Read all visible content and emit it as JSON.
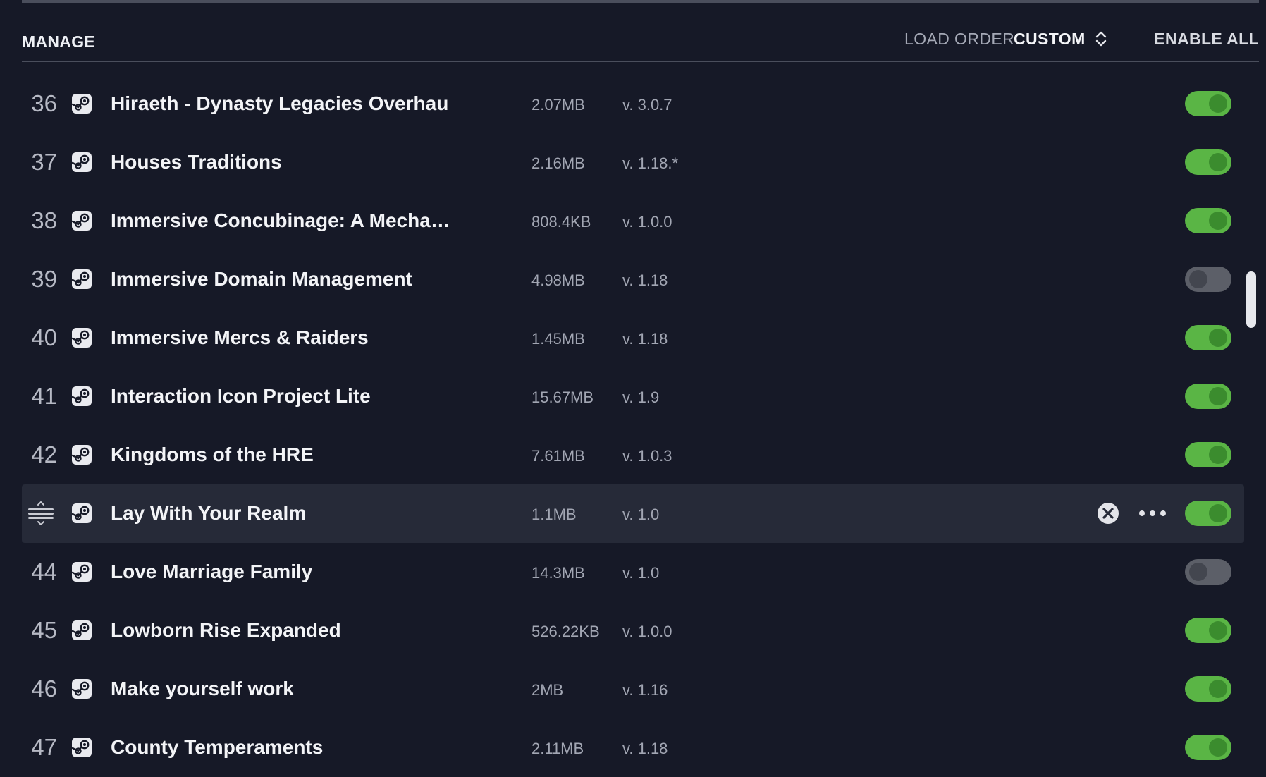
{
  "header": {
    "manage_label": "MANAGE",
    "load_order_label": "LOAD ORDER",
    "load_order_value": "CUSTOM",
    "enable_all_label": "ENABLE ALL"
  },
  "mods": [
    {
      "num": "36",
      "name": "Hiraeth - Dynasty Legacies Overhaul",
      "size": "2.07MB",
      "version": "v. 3.0.7",
      "enabled": true,
      "highlighted": false
    },
    {
      "num": "37",
      "name": "Houses Traditions",
      "size": "2.16MB",
      "version": "v. 1.18.*",
      "enabled": true,
      "highlighted": false
    },
    {
      "num": "38",
      "name": "Immersive Concubinage: A Mecha…",
      "size": "808.4KB",
      "version": "v. 1.0.0",
      "enabled": true,
      "highlighted": false
    },
    {
      "num": "39",
      "name": "Immersive Domain Management",
      "size": "4.98MB",
      "version": "v. 1.18",
      "enabled": false,
      "highlighted": false
    },
    {
      "num": "40",
      "name": "Immersive Mercs & Raiders",
      "size": "1.45MB",
      "version": "v. 1.18",
      "enabled": true,
      "highlighted": false
    },
    {
      "num": "41",
      "name": "Interaction Icon Project Lite",
      "size": "15.67MB",
      "version": "v. 1.9",
      "enabled": true,
      "highlighted": false
    },
    {
      "num": "42",
      "name": "Kingdoms of the HRE",
      "size": "7.61MB",
      "version": "v. 1.0.3",
      "enabled": true,
      "highlighted": false
    },
    {
      "num": "",
      "name": "Lay With Your Realm",
      "size": "1.1MB",
      "version": "v. 1.0",
      "enabled": true,
      "highlighted": true
    },
    {
      "num": "44",
      "name": "Love Marriage Family",
      "size": "14.3MB",
      "version": "v. 1.0",
      "enabled": false,
      "highlighted": false
    },
    {
      "num": "45",
      "name": "Lowborn Rise Expanded",
      "size": "526.22KB",
      "version": "v. 1.0.0",
      "enabled": true,
      "highlighted": false
    },
    {
      "num": "46",
      "name": "Make yourself work",
      "size": "2MB",
      "version": "v. 1.16",
      "enabled": true,
      "highlighted": false
    },
    {
      "num": "47",
      "name": "County Temperaments",
      "size": "2.11MB",
      "version": "v. 1.18",
      "enabled": true,
      "highlighted": false
    }
  ],
  "icons": {
    "source": "steam-icon",
    "drag": "drag-handle-icon",
    "remove": "close-circle-icon",
    "more": "more-horizontal-icon",
    "sort": "sort-updown-icon"
  },
  "colors": {
    "background": "#161927",
    "row_highlight": "#262a38",
    "toggle_on": "#5ab545",
    "toggle_knob_on": "#3b8c2e",
    "toggle_off": "#5c5f68"
  }
}
